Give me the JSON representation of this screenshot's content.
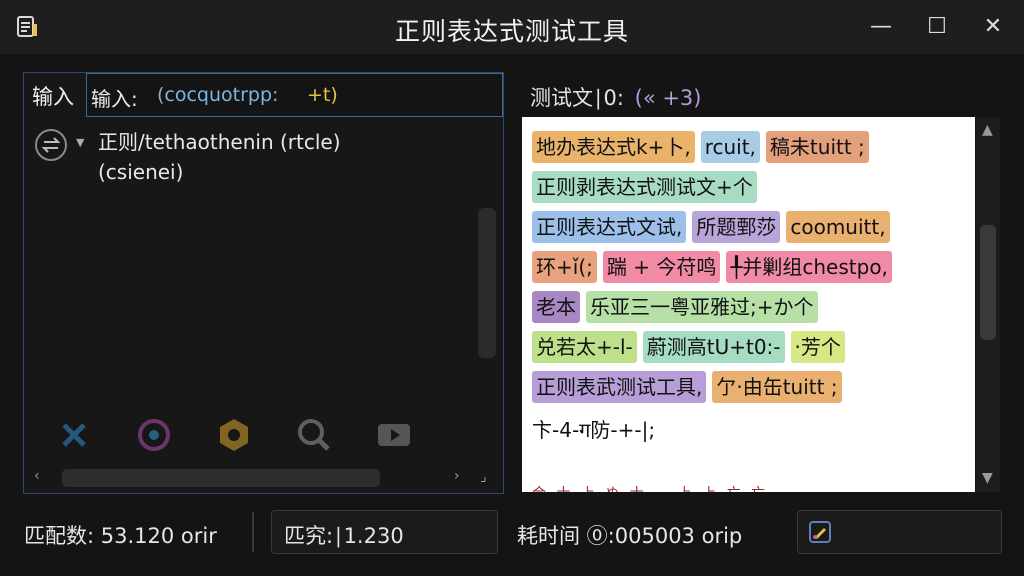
{
  "window": {
    "title": "正则表达式测试工具",
    "controls": {
      "minimize": "—",
      "maximize": "☐",
      "close": "✕"
    }
  },
  "left": {
    "tab_label": "输入",
    "input_prefix": "输入:",
    "input_pattern": "(cocquotrpp:",
    "input_tail": "+t)",
    "option_line1": "正则/tethaothenin (rtcle)",
    "option_line2": "(csienei)",
    "tools": [
      "x-icon",
      "target-icon",
      "gear-icon",
      "search-icon",
      "play-icon"
    ]
  },
  "right": {
    "label": "测试文∣0:",
    "hint": "(« +3)",
    "lines": [
      [
        {
          "t": "地办表达式k+卜,",
          "c": "#e9b46a"
        },
        {
          "t": "rcuit,",
          "c": "#a8cce6"
        },
        {
          "t": "稿未tuitt ;",
          "c": "#e3a07b"
        }
      ],
      [
        {
          "t": "正则剥表达式测试文+个",
          "c": "#a8dcc2"
        }
      ],
      [
        {
          "t": "正则表达式文试,",
          "c": "#9cc0ea"
        },
        {
          "t": "所题鄄莎",
          "c": "#b8a4d8"
        },
        {
          "t": "coomuitt,",
          "c": "#e9b070"
        }
      ],
      [
        {
          "t": "环+ǐ(;",
          "c": "#e9a27e"
        },
        {
          "t": "踹 + 今苻鸣",
          "c": "#f08aa5"
        },
        {
          "t": "╀并剿组chestpo,",
          "c": "#f08aa5"
        }
      ],
      [
        {
          "t": "老本",
          "c": "#a887c4"
        },
        {
          "t": "乐亚三一粤亚雅过;+か个",
          "c": "#b6e0a6"
        }
      ],
      [
        {
          "t": "兑若太+-l-",
          "c": "#bfe08a"
        },
        {
          "t": "蔚测高tU+t0:-",
          "c": "#a6dcc2"
        },
        {
          "t": "·芳个",
          "c": "#d6e886"
        }
      ],
      [
        {
          "t": "正则表武测试工具,",
          "c": "#b79ed8"
        },
        {
          "t": "亇·由缶tuitt ;",
          "c": "#e9b070"
        }
      ]
    ],
    "plain_line": "卞-4-ग防-+-|;",
    "cut_text": "合 士 上 ぬ 士 -- 上 上 亡 亡"
  },
  "status": {
    "match_count": "匹配数: 53.120 orir",
    "match_detail": "匹究:∣1.230",
    "elapsed": "耗时间 ⓪:005003 orip"
  },
  "colors": {
    "accent": "#3c6aa0",
    "background": "#141414",
    "test_bg": "#ffffff"
  }
}
